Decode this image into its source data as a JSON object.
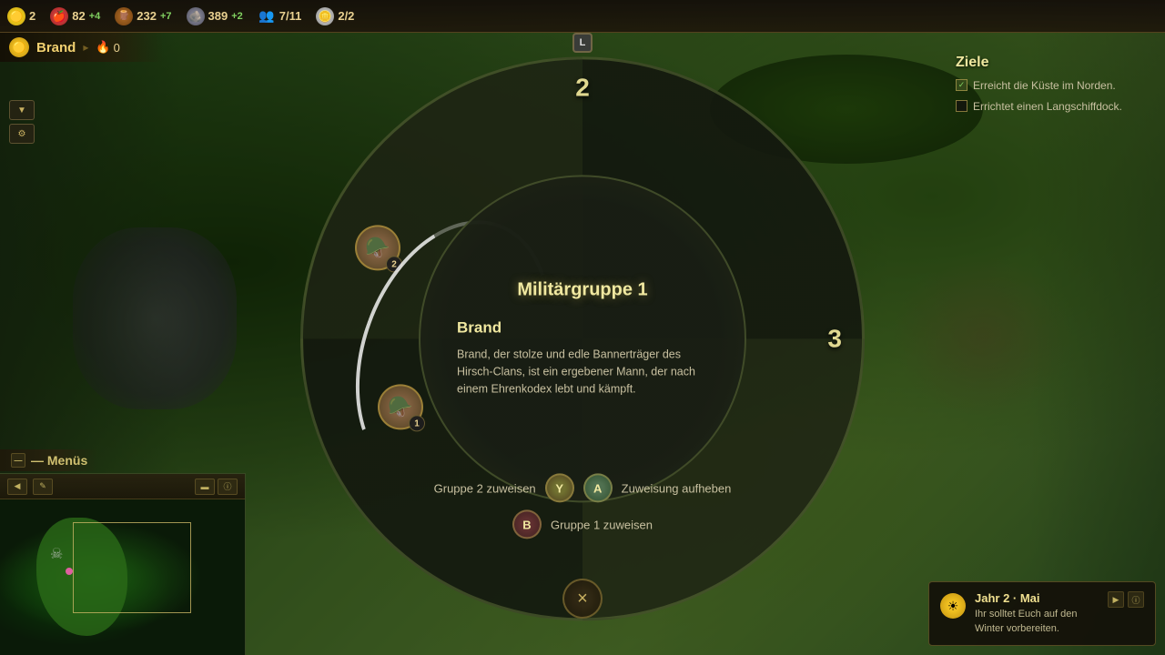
{
  "resources": {
    "gold": {
      "icon": "🟡",
      "value": "2",
      "plus": ""
    },
    "food": {
      "icon": "🍎",
      "value": "82",
      "plus": "+4"
    },
    "wood": {
      "icon": "🪵",
      "value": "232",
      "plus": "+7"
    },
    "stone": {
      "icon": "🪨",
      "value": "389",
      "plus": "+2"
    },
    "people": {
      "icon": "👥",
      "value": "7/11",
      "plus": ""
    },
    "coins": {
      "value": "2/2",
      "plus": ""
    }
  },
  "player": {
    "name": "Brand",
    "score_icon": "🔥",
    "score": "0",
    "l_button": "L"
  },
  "dialog": {
    "title": "Militärgruppe 1",
    "unit1": {
      "emoji": "🪖",
      "badge": "2"
    },
    "unit2": {
      "emoji": "🪖",
      "badge": "1"
    },
    "character_name": "Brand",
    "character_desc": "Brand, der stolze und edle Bannerträger des Hirsch-Clans, ist ein ergebener Mann, der nach einem Ehrenkodex lebt und kämpft.",
    "ring_number_2": "2",
    "ring_number_3": "3",
    "actions": {
      "assign_group2_label": "Gruppe 2 zuweisen",
      "btn_y": "Y",
      "btn_a": "A",
      "unassign_label": "Zuweisung aufheben",
      "btn_b": "B",
      "assign_group1_label": "Gruppe 1 zuweisen"
    },
    "close_label": "×"
  },
  "minimap": {
    "title": "— Menüs",
    "left_btn": "◀",
    "ctrl_btns": [
      "▲",
      "✎",
      "▬",
      "ⓘ"
    ]
  },
  "objectives": {
    "title": "Ziele",
    "items": [
      {
        "text": "Erreicht die Küste im Norden.",
        "checked": true
      },
      {
        "text": "Errichtet einen Langschiffdock.",
        "checked": false
      }
    ]
  },
  "season": {
    "icon": "☀",
    "title": "Jahr 2 · Mai",
    "desc": "Ihr solltet Euch auf den Winter vorbereiten.",
    "nav_next": "▶",
    "nav_info": "ⓘ"
  }
}
